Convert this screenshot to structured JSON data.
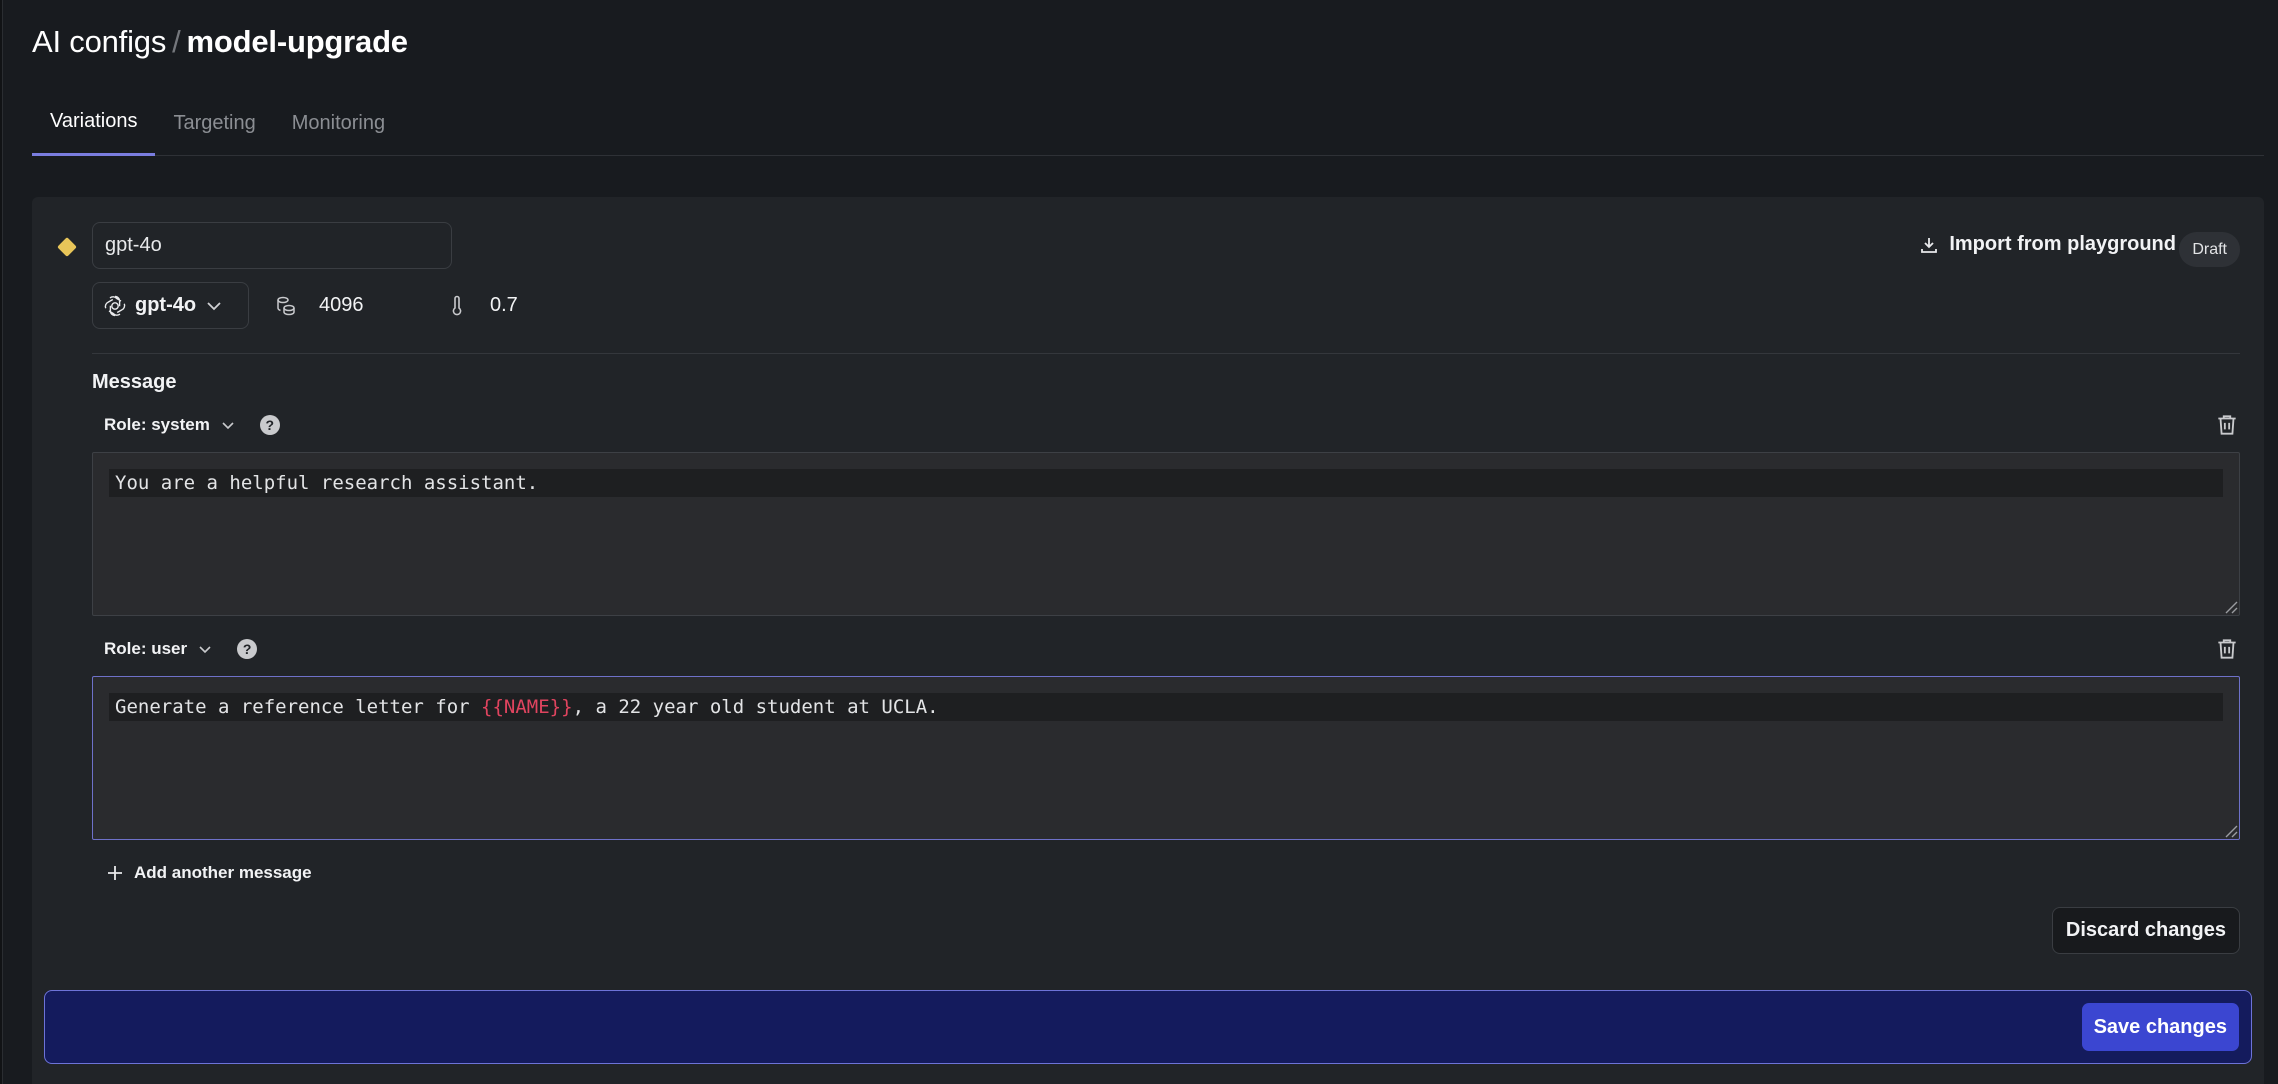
{
  "breadcrumb": {
    "parent": "AI configs",
    "separator": "/",
    "current": "model-upgrade"
  },
  "tabs": [
    {
      "label": "Variations",
      "active": true
    },
    {
      "label": "Targeting",
      "active": false
    },
    {
      "label": "Monitoring",
      "active": false
    }
  ],
  "variation": {
    "indicator_icon": "diamond-icon",
    "indicator_color": "#e8c559",
    "name_value": "gpt-4o",
    "status_badge": "Draft",
    "import_label": "Import from playground",
    "model": {
      "icon": "openai-logo-icon",
      "selected": "gpt-4o"
    },
    "max_tokens": {
      "icon": "tokens-icon",
      "value": "4096"
    },
    "temperature": {
      "icon": "thermometer-icon",
      "value": "0.7"
    }
  },
  "messages_section": {
    "label": "Message",
    "messages": [
      {
        "role_label": "Role: system",
        "text": "You are a helpful research assistant."
      },
      {
        "role_label": "Role: user",
        "text_before": "Generate a reference letter for ",
        "variable": "{{NAME}}",
        "text_after": ", a 22 year old student at UCLA.",
        "focused": true
      }
    ],
    "add_label": "Add another message"
  },
  "actions": {
    "discard_label": "Discard changes",
    "save_label": "Save changes"
  },
  "colors": {
    "accent": "#7a7ddf",
    "save_button": "#3b46d1",
    "save_bar": "#141b5d",
    "variable_highlight": "#e0445f"
  }
}
